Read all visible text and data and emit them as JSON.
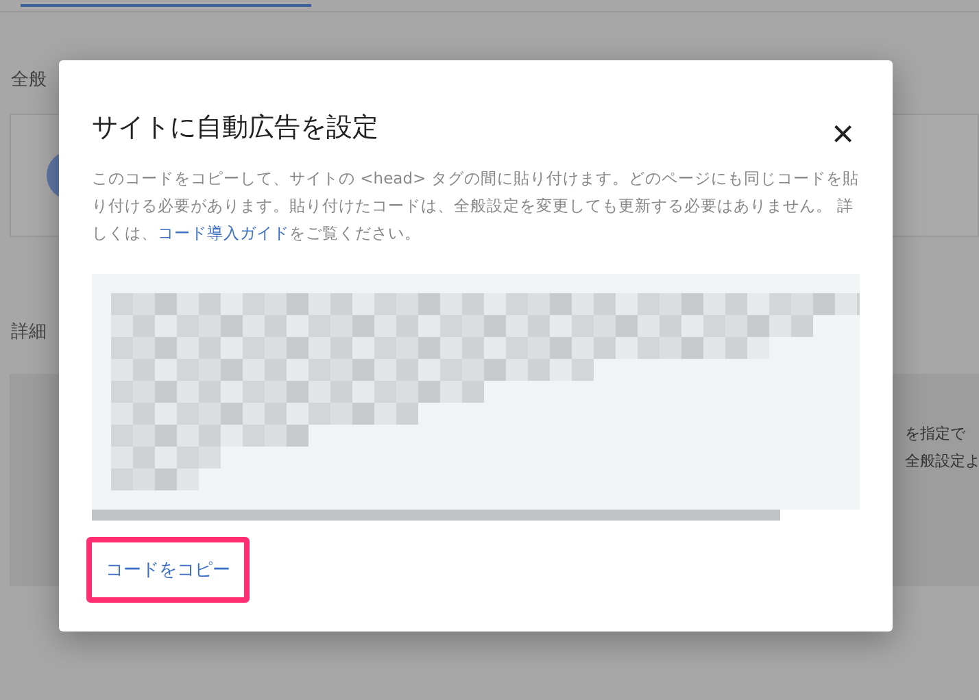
{
  "background": {
    "section_1": "全般",
    "section_2": "詳細",
    "panel_lines": [
      "を指定で",
      "全般設定よ"
    ]
  },
  "dialog": {
    "title": "サイトに自動広告を設定",
    "close": "×",
    "description": {
      "before": "このコードをコピーして、サイトの <head> タグの間に貼り付けます。どのページにも同じコードを貼り付ける必要があります。貼り付けたコードは、全般設定を変更しても更新する必要はありません。 詳しくは、",
      "link": "コード導入ガイド",
      "after": "をご覧ください。"
    },
    "copy_button": "コードをコピー"
  }
}
